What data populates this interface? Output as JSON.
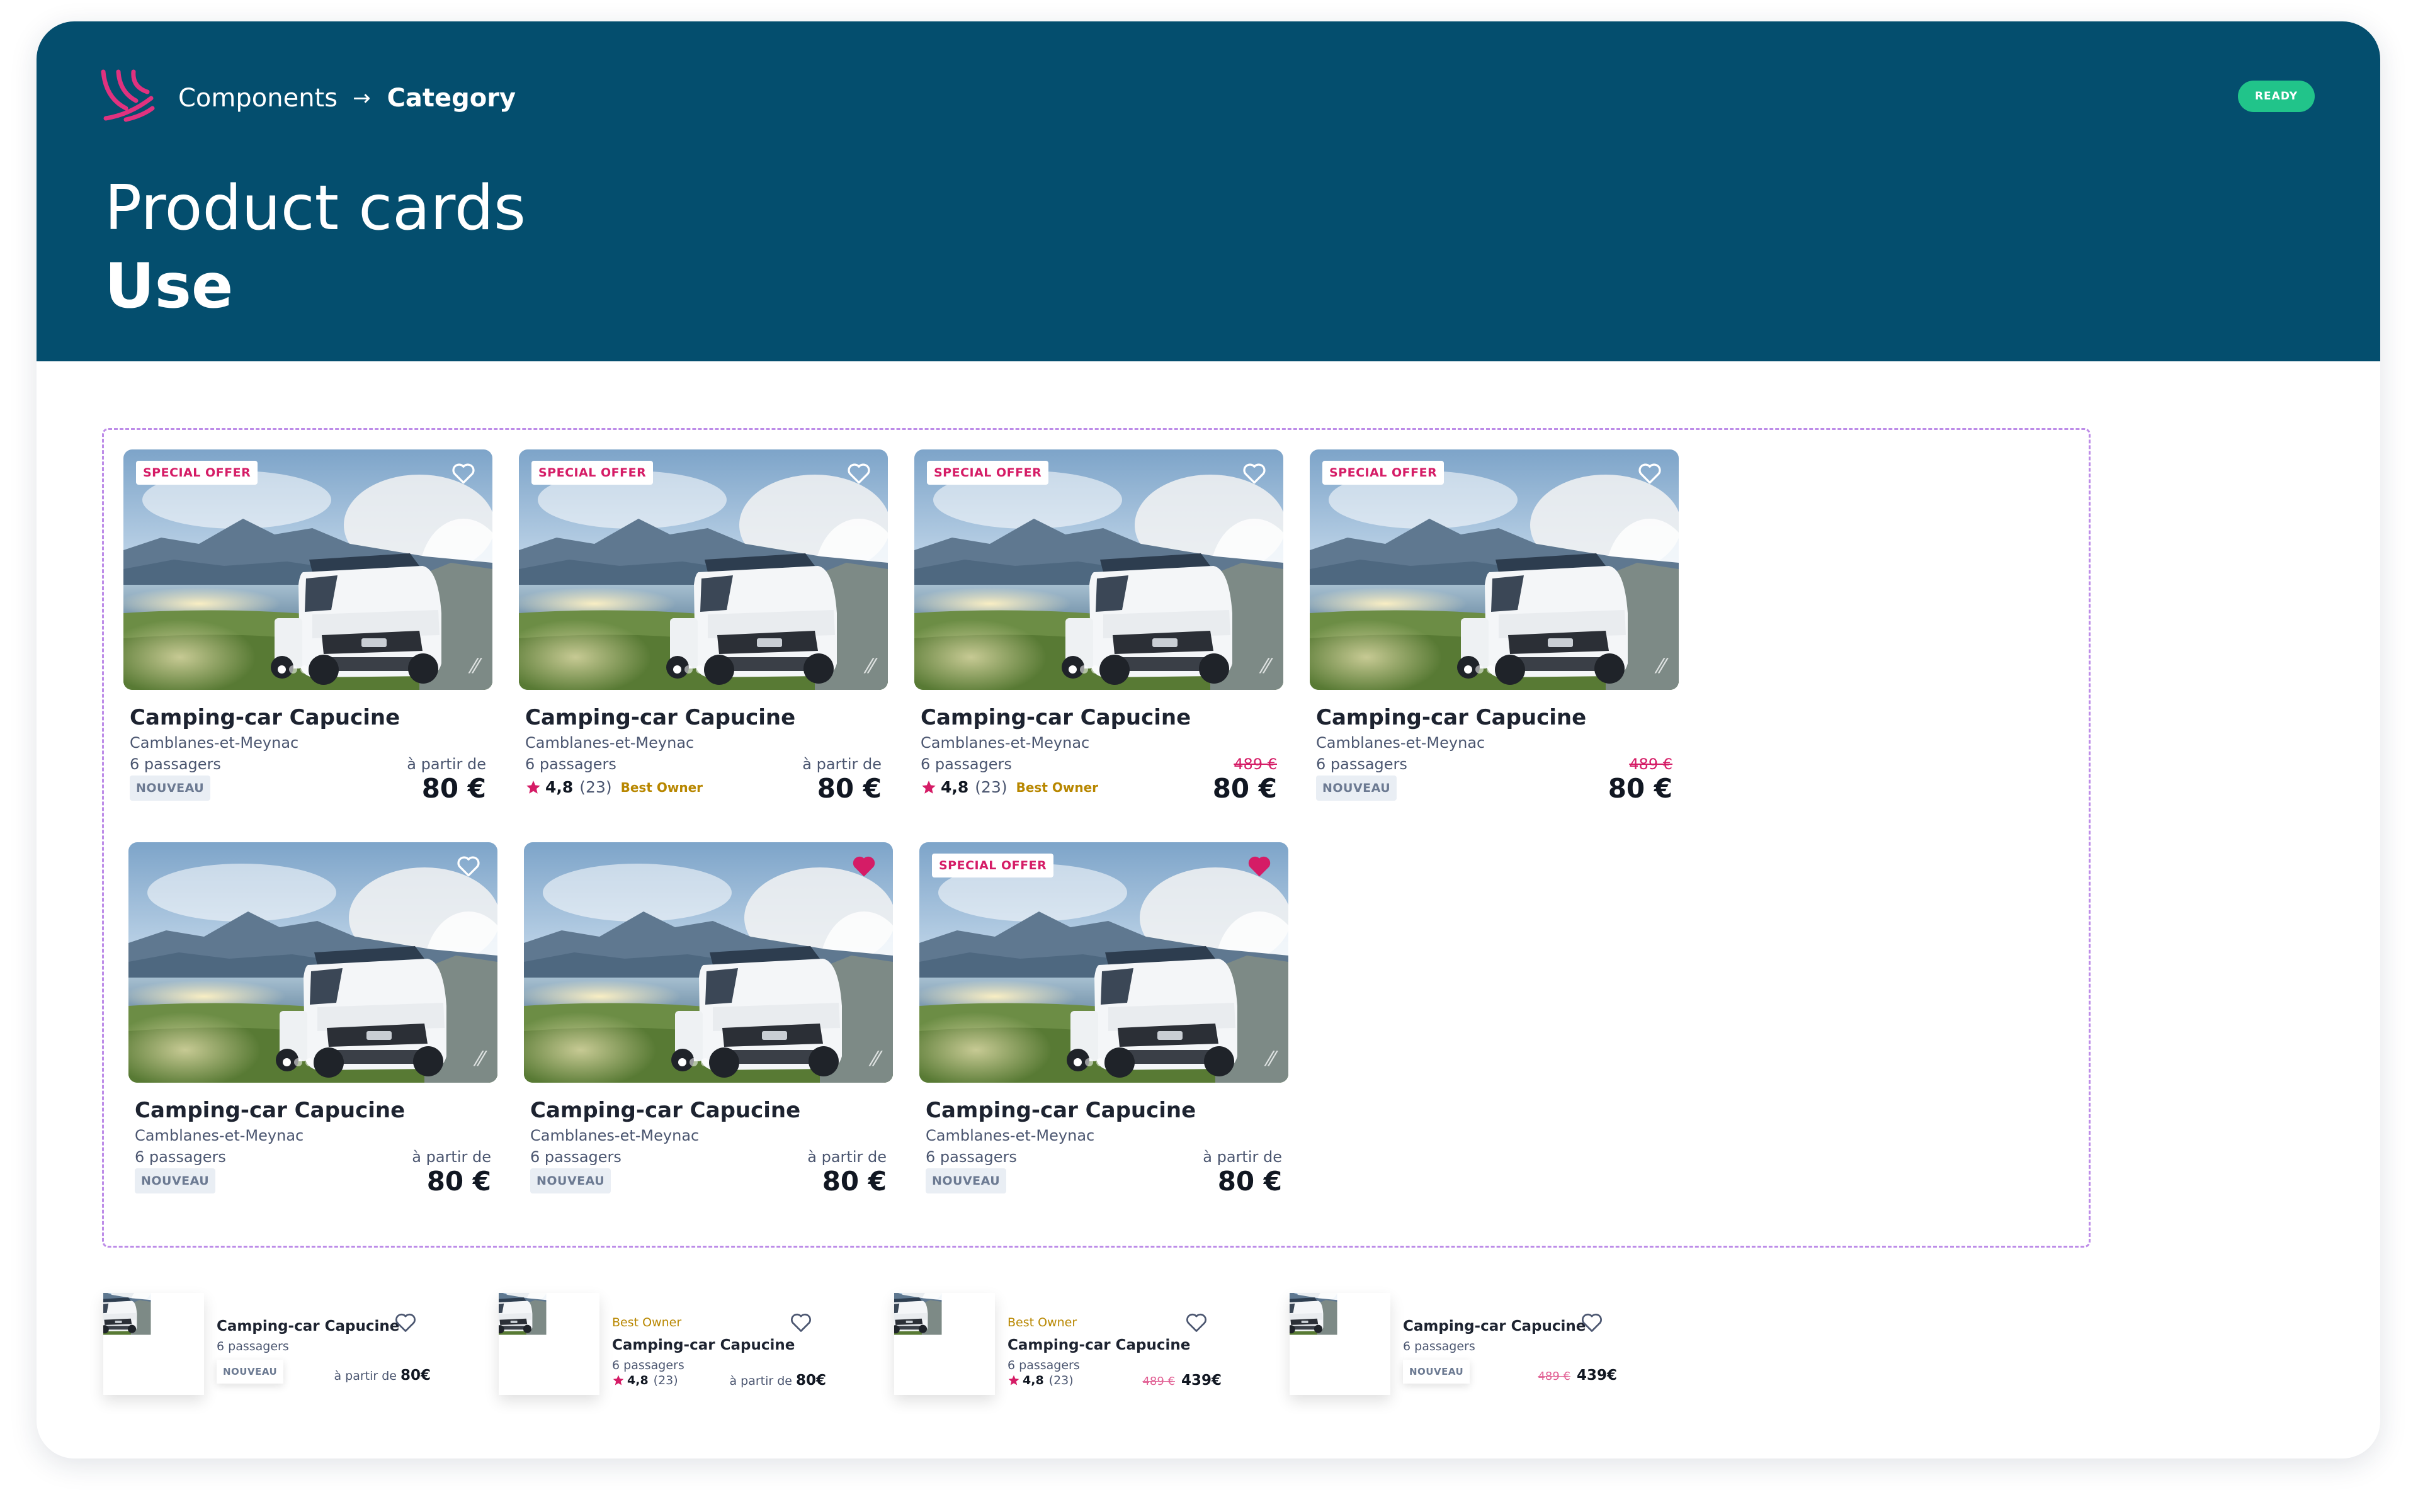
{
  "header": {
    "breadcrumb": [
      "Components",
      "Category"
    ],
    "status": "READY",
    "title": "Product cards",
    "subtitle": "Use"
  },
  "cards": [
    {
      "special_offer": "SPECIAL OFFER",
      "favorited": false,
      "title": "Camping-car Capucine",
      "location": "Camblanes-et-Meynac",
      "passengers": "6 passagers",
      "price_label": "à partir de",
      "price": "80 €",
      "badge": "NOUVEAU"
    },
    {
      "special_offer": "SPECIAL OFFER",
      "favorited": false,
      "title": "Camping-car Capucine",
      "location": "Camblanes-et-Meynac",
      "passengers": "6 passagers",
      "price_label": "à partir de",
      "price": "80 €",
      "rating": "4,8",
      "reviews": "(23)",
      "owner_badge": "Best Owner"
    },
    {
      "special_offer": "SPECIAL OFFER",
      "favorited": false,
      "title": "Camping-car Capucine",
      "location": "Camblanes-et-Meynac",
      "passengers": "6 passagers",
      "old_price": "489 €",
      "price": "80 €",
      "rating": "4,8",
      "reviews": "(23)",
      "owner_badge": "Best Owner"
    },
    {
      "special_offer": "SPECIAL OFFER",
      "favorited": false,
      "title": "Camping-car Capucine",
      "location": "Camblanes-et-Meynac",
      "passengers": "6 passagers",
      "old_price": "489 €",
      "price": "80 €",
      "badge": "NOUVEAU"
    },
    {
      "favorited": false,
      "title": "Camping-car Capucine",
      "location": "Camblanes-et-Meynac",
      "passengers": "6 passagers",
      "price_label": "à partir de",
      "price": "80 €",
      "badge": "NOUVEAU"
    },
    {
      "favorited": true,
      "title": "Camping-car Capucine",
      "location": "Camblanes-et-Meynac",
      "passengers": "6 passagers",
      "price_label": "à partir de",
      "price": "80 €",
      "badge": "NOUVEAU"
    },
    {
      "special_offer": "SPECIAL OFFER",
      "favorited": true,
      "title": "Camping-car Capucine",
      "location": "Camblanes-et-Meynac",
      "passengers": "6 passagers",
      "price_label": "à partir de",
      "price": "80 €",
      "badge": "NOUVEAU"
    }
  ],
  "mini_cards": [
    {
      "title": "Camping-car Capucine",
      "passengers": "6 passagers",
      "badge": "NOUVEAU",
      "price_label": "à partir de",
      "price": "80€"
    },
    {
      "owner_badge": "Best Owner",
      "title": "Camping-car Capucine",
      "passengers": "6 passagers",
      "rating": "4,8",
      "reviews": "(23)",
      "price_label": "à partir de",
      "price": "80€"
    },
    {
      "owner_badge": "Best Owner",
      "title": "Camping-car Capucine",
      "passengers": "6 passagers",
      "rating": "4,8",
      "reviews": "(23)",
      "old_price": "489 €",
      "price": "439€"
    },
    {
      "title": "Camping-car Capucine",
      "passengers": "6 passagers",
      "badge": "NOUVEAU",
      "old_price": "489 €",
      "price": "439€"
    }
  ],
  "colors": {
    "header_bg": "#044e6e",
    "ready_badge": "#21c48a",
    "accent_pink": "#d51c66",
    "best_owner": "#b88700",
    "dashed_border": "#bd8ce8"
  },
  "icons": [
    "brand-logo-icon",
    "arrow-right-icon",
    "heart-outline-icon",
    "heart-filled-icon",
    "star-icon"
  ]
}
